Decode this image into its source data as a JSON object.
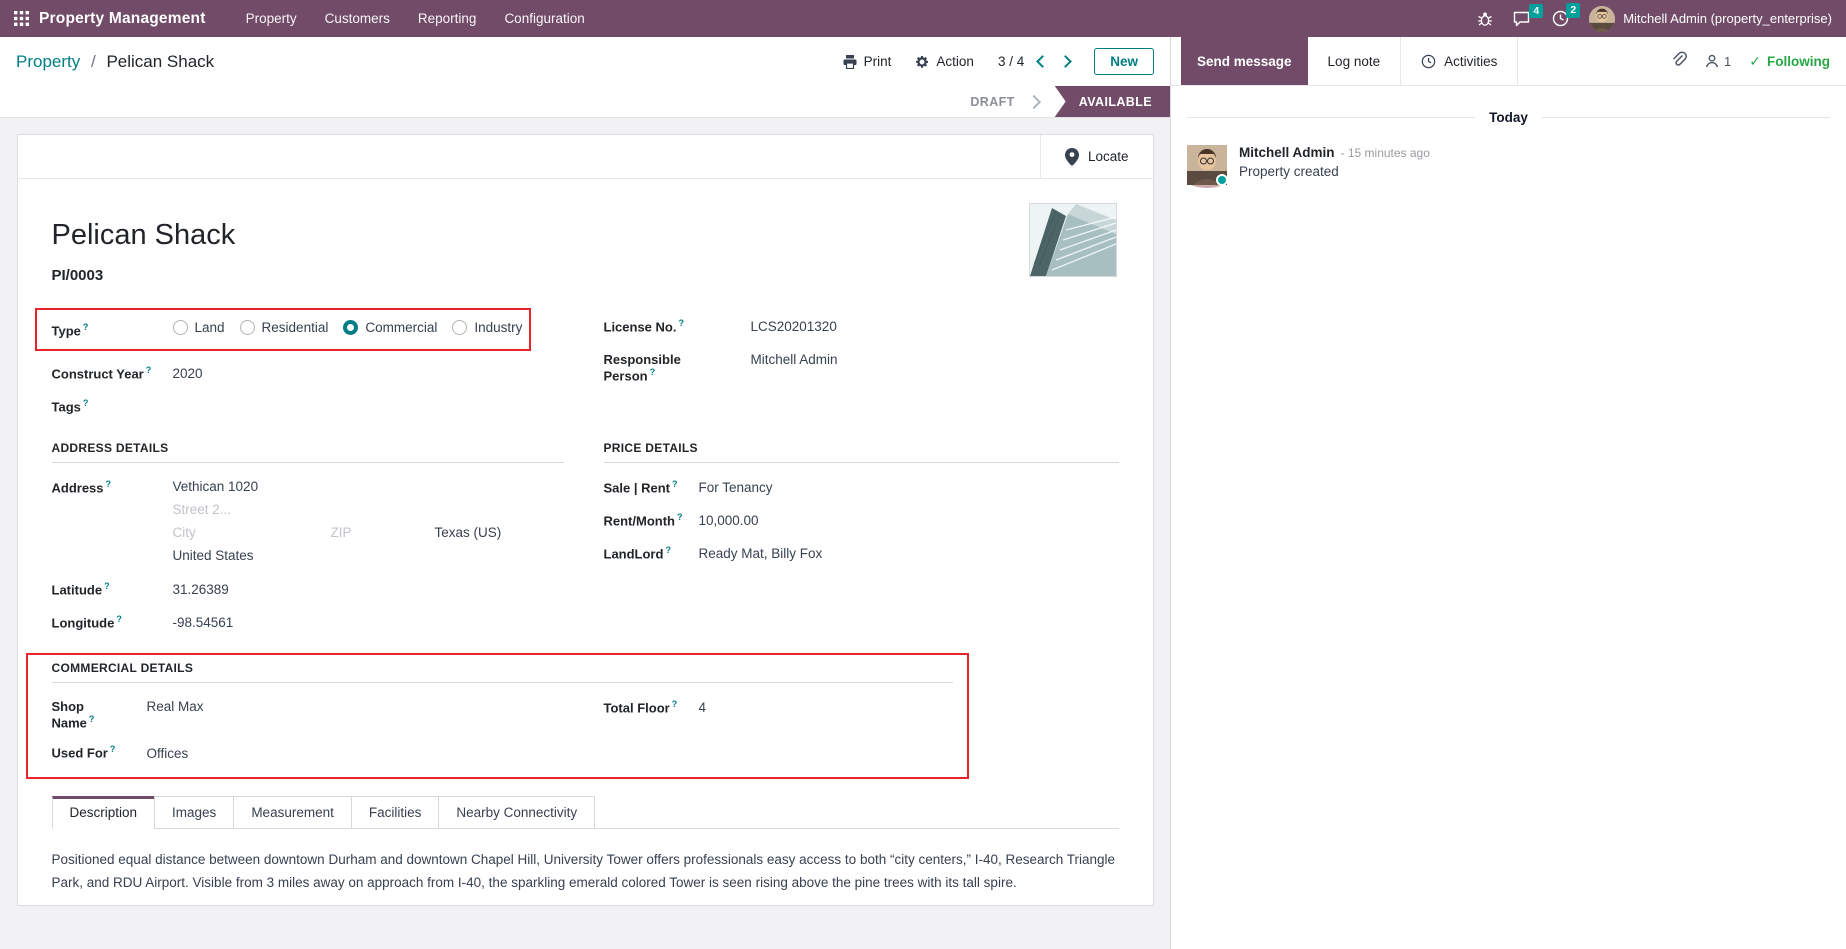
{
  "ui": {
    "help": "?"
  },
  "colors": {
    "primary": "#714B67",
    "accent": "#017E84",
    "badge": "#00A09D",
    "success": "#28a745",
    "annotation": "#E8232A"
  },
  "navbar": {
    "app_name": "Property Management",
    "menus": [
      "Property",
      "Customers",
      "Reporting",
      "Configuration"
    ],
    "messages_badge": "4",
    "activities_badge": "2",
    "user_name": "Mitchell Admin (property_enterprise)"
  },
  "control_panel": {
    "breadcrumb_root": "Property",
    "breadcrumb_sep": "/",
    "breadcrumb_current": "Pelican Shack",
    "print_label": "Print",
    "action_label": "Action",
    "pager": "3 / 4",
    "new_label": "New"
  },
  "statusbar": {
    "draft": "DRAFT",
    "available": "AVAILABLE"
  },
  "form": {
    "locate_label": "Locate",
    "title": "Pelican Shack",
    "reference": "PI/0003",
    "fields": {
      "type_label": "Type",
      "type_options": [
        "Land",
        "Residential",
        "Commercial",
        "Industry"
      ],
      "type_selected": "Commercial",
      "construct_year_label": "Construct Year",
      "construct_year": "2020",
      "tags_label": "Tags",
      "license_label": "License No.",
      "license": "LCS20201320",
      "responsible_label": "Responsible Person",
      "responsible": "Mitchell Admin"
    },
    "address_section": {
      "title": "ADDRESS DETAILS",
      "address_label": "Address",
      "street": "Vethican 1020",
      "street2_placeholder": "Street 2...",
      "city_placeholder": "City",
      "zip_placeholder": "ZIP",
      "state": "Texas (US)",
      "country": "United States",
      "latitude_label": "Latitude",
      "latitude": "31.26389",
      "longitude_label": "Longitude",
      "longitude": "-98.54561"
    },
    "price_section": {
      "title": "PRICE DETAILS",
      "sale_rent_label": "Sale | Rent",
      "sale_rent": "For Tenancy",
      "rent_month_label": "Rent/Month",
      "rent_month": "10,000.00",
      "landlord_label": "LandLord",
      "landlord": "Ready Mat, Billy Fox"
    },
    "commercial_section": {
      "title": "COMMERCIAL DETAILS",
      "shop_name_label": "Shop Name",
      "shop_name": "Real Max",
      "used_for_label": "Used For",
      "used_for": "Offices",
      "total_floor_label": "Total Floor",
      "total_floor": "4"
    },
    "tabs": [
      "Description",
      "Images",
      "Measurement",
      "Facilities",
      "Nearby Connectivity"
    ],
    "active_tab": "Description",
    "description": "Positioned equal distance between downtown Durham and downtown Chapel Hill, University Tower offers professionals easy access to both “city centers,” I-40, Research Triangle Park, and RDU Airport. Visible from 3 miles away on approach from I-40, the sparkling emerald colored Tower is seen rising above the pine trees with its tall spire."
  },
  "chatter": {
    "send_message": "Send message",
    "log_note": "Log note",
    "activities": "Activities",
    "followers_count": "1",
    "following": "Following",
    "today": "Today",
    "message": {
      "author": "Mitchell Admin",
      "time": "- 15 minutes ago",
      "body": "Property created"
    }
  }
}
